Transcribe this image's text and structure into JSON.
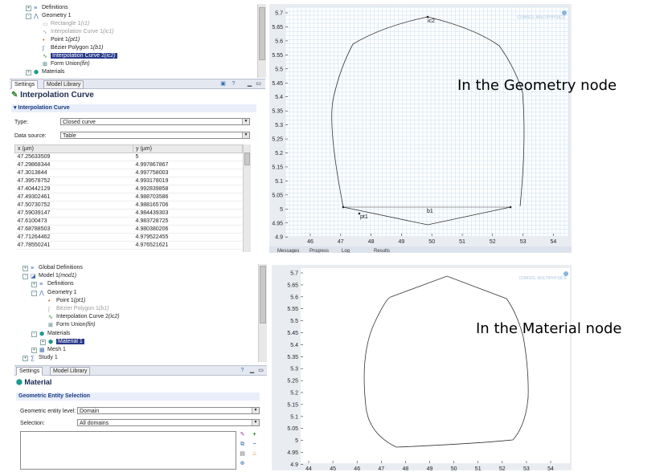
{
  "top": {
    "tree": [
      {
        "label": "Definitions",
        "tag": "",
        "disabled": false,
        "indent": 0,
        "icon": "definitions-icon",
        "expander": "+"
      },
      {
        "label": "Geometry 1",
        "tag": "",
        "disabled": false,
        "indent": 0,
        "icon": "geometry-icon",
        "expander": "-"
      },
      {
        "label": "Rectangle 1",
        "tag": "(r1)",
        "disabled": true,
        "indent": 1,
        "icon": "rectangle-icon",
        "expander": ""
      },
      {
        "label": "Interpolation Curve 1",
        "tag": "(ic1)",
        "disabled": true,
        "indent": 1,
        "icon": "interpolation-curve-icon",
        "expander": ""
      },
      {
        "label": "Point 1",
        "tag": "(pt1)",
        "disabled": false,
        "indent": 1,
        "icon": "point-icon",
        "expander": ""
      },
      {
        "label": "Bézier Polygon 1",
        "tag": "(b1)",
        "disabled": false,
        "indent": 1,
        "icon": "bezier-polygon-icon",
        "expander": ""
      },
      {
        "label": "Interpolation Curve 2",
        "tag": "(ic2)",
        "disabled": false,
        "indent": 1,
        "icon": "interpolation-curve-icon",
        "expander": "",
        "selected": true
      },
      {
        "label": "Form Union",
        "tag": "(fin)",
        "disabled": false,
        "indent": 1,
        "icon": "form-union-icon",
        "expander": ""
      },
      {
        "label": "Materials",
        "tag": "",
        "disabled": false,
        "indent": 0,
        "icon": "materials-icon",
        "expander": "+"
      }
    ],
    "tabs": [
      "Settings",
      "Model Library"
    ],
    "panel_title": "Interpolation Curve",
    "section_title": "Interpolation Curve",
    "type_label": "Type:",
    "type_value": "Closed curve",
    "source_label": "Data source:",
    "source_value": "Table",
    "table": {
      "headers": [
        "x (µm)",
        "y (µm)"
      ],
      "rows": [
        [
          "47.25633509",
          "5"
        ],
        [
          "47.29868344",
          "4.997867867"
        ],
        [
          "47.3013844",
          "4.997758003"
        ],
        [
          "47.39578752",
          "4.993178019"
        ],
        [
          "47.40442129",
          "4.992839858"
        ],
        [
          "47.49302461",
          "4.988703586"
        ],
        [
          "47.50730752",
          "4.988165706"
        ],
        [
          "47.59039147",
          "4.984439303"
        ],
        [
          "47.6100473",
          "4.983728725"
        ],
        [
          "47.68788503",
          "4.980380206"
        ],
        [
          "47.71264462",
          "4.979522455"
        ],
        [
          "47.78550241",
          "4.976521621"
        ]
      ]
    },
    "plot": {
      "y_ticks": [
        "5.7",
        "5.65",
        "5.6",
        "5.55",
        "5.5",
        "5.45",
        "5.4",
        "5.35",
        "5.3",
        "5.25",
        "5.2",
        "5.15",
        "5.1",
        "5.05",
        "5",
        "4.95",
        "4.9"
      ],
      "x_ticks": [
        "46",
        "47",
        "48",
        "49",
        "50",
        "51",
        "52",
        "53",
        "54"
      ],
      "labels": {
        "ic2": "ic2",
        "b1": "b1",
        "pt1": "pt1"
      },
      "watermark": "COMSOL MULTIPHYSICS",
      "bottom_tabs": [
        "Messages",
        "Progress",
        "Log",
        "Results"
      ]
    },
    "annotation": "In the Geometry node"
  },
  "bottom": {
    "tree": [
      {
        "label": "Global Definitions",
        "tag": "",
        "disabled": false,
        "indent": 0,
        "icon": "global-definitions-icon",
        "expander": "+"
      },
      {
        "label": "Model 1",
        "tag": "(mod1)",
        "disabled": false,
        "indent": 0,
        "icon": "model-icon",
        "expander": "-"
      },
      {
        "label": "Definitions",
        "tag": "",
        "disabled": false,
        "indent": 1,
        "icon": "definitions-icon",
        "expander": "+"
      },
      {
        "label": "Geometry 1",
        "tag": "",
        "disabled": false,
        "indent": 1,
        "icon": "geometry-icon",
        "expander": "-"
      },
      {
        "label": "Point 1",
        "tag": "(pt1)",
        "disabled": false,
        "indent": 2,
        "icon": "point-icon",
        "expander": ""
      },
      {
        "label": "Bézier Polygon 1",
        "tag": "(b1)",
        "disabled": true,
        "indent": 2,
        "icon": "bezier-polygon-icon",
        "expander": ""
      },
      {
        "label": "Interpolation Curve 2",
        "tag": "(ic2)",
        "disabled": false,
        "indent": 2,
        "icon": "interpolation-curve-icon",
        "expander": ""
      },
      {
        "label": "Form Union",
        "tag": "(fin)",
        "disabled": false,
        "indent": 2,
        "icon": "form-union-icon",
        "expander": ""
      },
      {
        "label": "Materials",
        "tag": "",
        "disabled": false,
        "indent": 1,
        "icon": "materials-icon",
        "expander": "-"
      },
      {
        "label": "Material 1",
        "tag": "",
        "disabled": false,
        "indent": 2,
        "icon": "material-icon",
        "expander": "+",
        "selected": true
      },
      {
        "label": "Mesh 1",
        "tag": "",
        "disabled": false,
        "indent": 1,
        "icon": "mesh-icon",
        "expander": "+"
      },
      {
        "label": "Study 1",
        "tag": "",
        "disabled": false,
        "indent": 0,
        "icon": "study-icon",
        "expander": "+"
      }
    ],
    "tabs": [
      "Settings",
      "Model Library"
    ],
    "panel_title": "Material",
    "section_title": "Geometric Entity Selection",
    "level_label": "Geometric entity level:",
    "level_value": "Domain",
    "selection_label": "Selection:",
    "selection_value": "All domains",
    "plot": {
      "y_ticks": [
        "5.7",
        "5.65",
        "5.6",
        "5.55",
        "5.5",
        "5.45",
        "5.4",
        "5.35",
        "5.3",
        "5.25",
        "5.2",
        "5.15",
        "5.1",
        "5.05",
        "5",
        "4.95",
        "4.9"
      ],
      "x_ticks": [
        "44",
        "45",
        "46",
        "47",
        "48",
        "49",
        "50",
        "51",
        "52",
        "53",
        "54"
      ],
      "watermark": "COMSOL MULTIPHYSICS"
    },
    "annotation": "In the Material node"
  },
  "colors": {
    "selection": "#2a3a8a",
    "grid": "#c6dcef",
    "curve": "#333333"
  }
}
